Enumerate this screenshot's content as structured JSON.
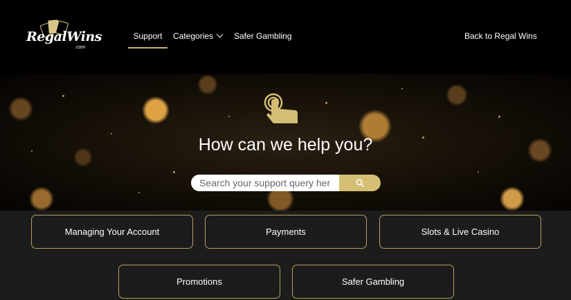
{
  "header": {
    "logo": {
      "word": "RegalWins",
      "suffix": ".com"
    },
    "nav": {
      "support": "Support",
      "categories": "Categories",
      "safer_gambling": "Safer Gambling"
    },
    "back_link": "Back to Regal Wins"
  },
  "hero": {
    "icon": "tap-hand-icon",
    "title": "How can we help you?",
    "search": {
      "placeholder": "Search your support query here",
      "value": "",
      "button_icon": "search-icon"
    }
  },
  "categories": [
    {
      "label": "Managing Your Account"
    },
    {
      "label": "Payments"
    },
    {
      "label": "Slots & Live Casino"
    },
    {
      "label": "Promotions"
    },
    {
      "label": "Safer Gambling"
    }
  ],
  "colors": {
    "accent": "#d4bf74",
    "border_gold": "#b59f5e",
    "header_bg": "#000000",
    "section_bg": "#1c1c1c"
  }
}
